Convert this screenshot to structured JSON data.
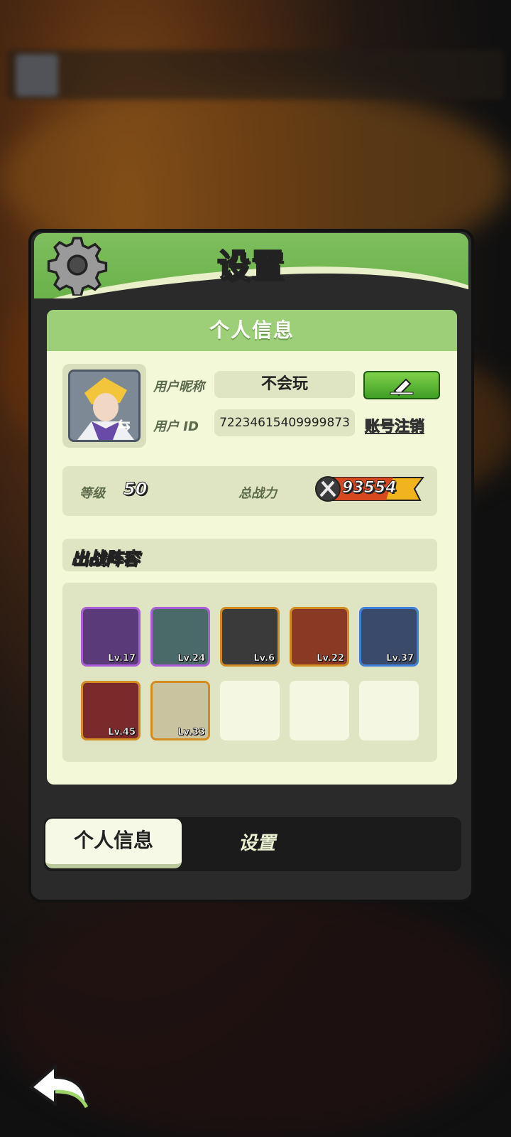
{
  "dialog": {
    "title": "设置",
    "panel_title": "个人信息"
  },
  "profile": {
    "nickname_label": "用户昵称",
    "nickname_value": "不会玩",
    "id_label": "用户 ID",
    "id_value": "72234615409999873",
    "cancel_account_label": "账号注销"
  },
  "stats": {
    "level_label": "等级",
    "level_value": "50",
    "power_label": "总战力",
    "power_value": "93554"
  },
  "lineup": {
    "title": "出战阵容",
    "heroes": [
      {
        "level": "Lv.17",
        "rarity": "purple",
        "color": "#5b3a7a"
      },
      {
        "level": "Lv.24",
        "rarity": "purple",
        "color": "#4a6a6a"
      },
      {
        "level": "Lv.6",
        "rarity": "orange",
        "color": "#3a3a3a"
      },
      {
        "level": "Lv.22",
        "rarity": "orange",
        "color": "#8a3a24"
      },
      {
        "level": "Lv.37",
        "rarity": "blue",
        "color": "#3a4a6a"
      },
      {
        "level": "Lv.45",
        "rarity": "orange",
        "color": "#7a2a2a"
      },
      {
        "level": "Lv.33",
        "rarity": "orange",
        "color": "#c9c3a0"
      }
    ],
    "empty_slots": 3
  },
  "tabs": {
    "active": "个人信息",
    "other": "设置"
  },
  "colors": {
    "accent_green": "#6ab24a",
    "panel_bg": "#f2f8d8",
    "edit_button": "#4fb02e"
  },
  "icons": {
    "header": "gear-icon",
    "edit": "pencil-icon",
    "power": "crossed-swords-icon",
    "back": "back-arrow-icon",
    "avatar_swap": "swap-icon"
  }
}
